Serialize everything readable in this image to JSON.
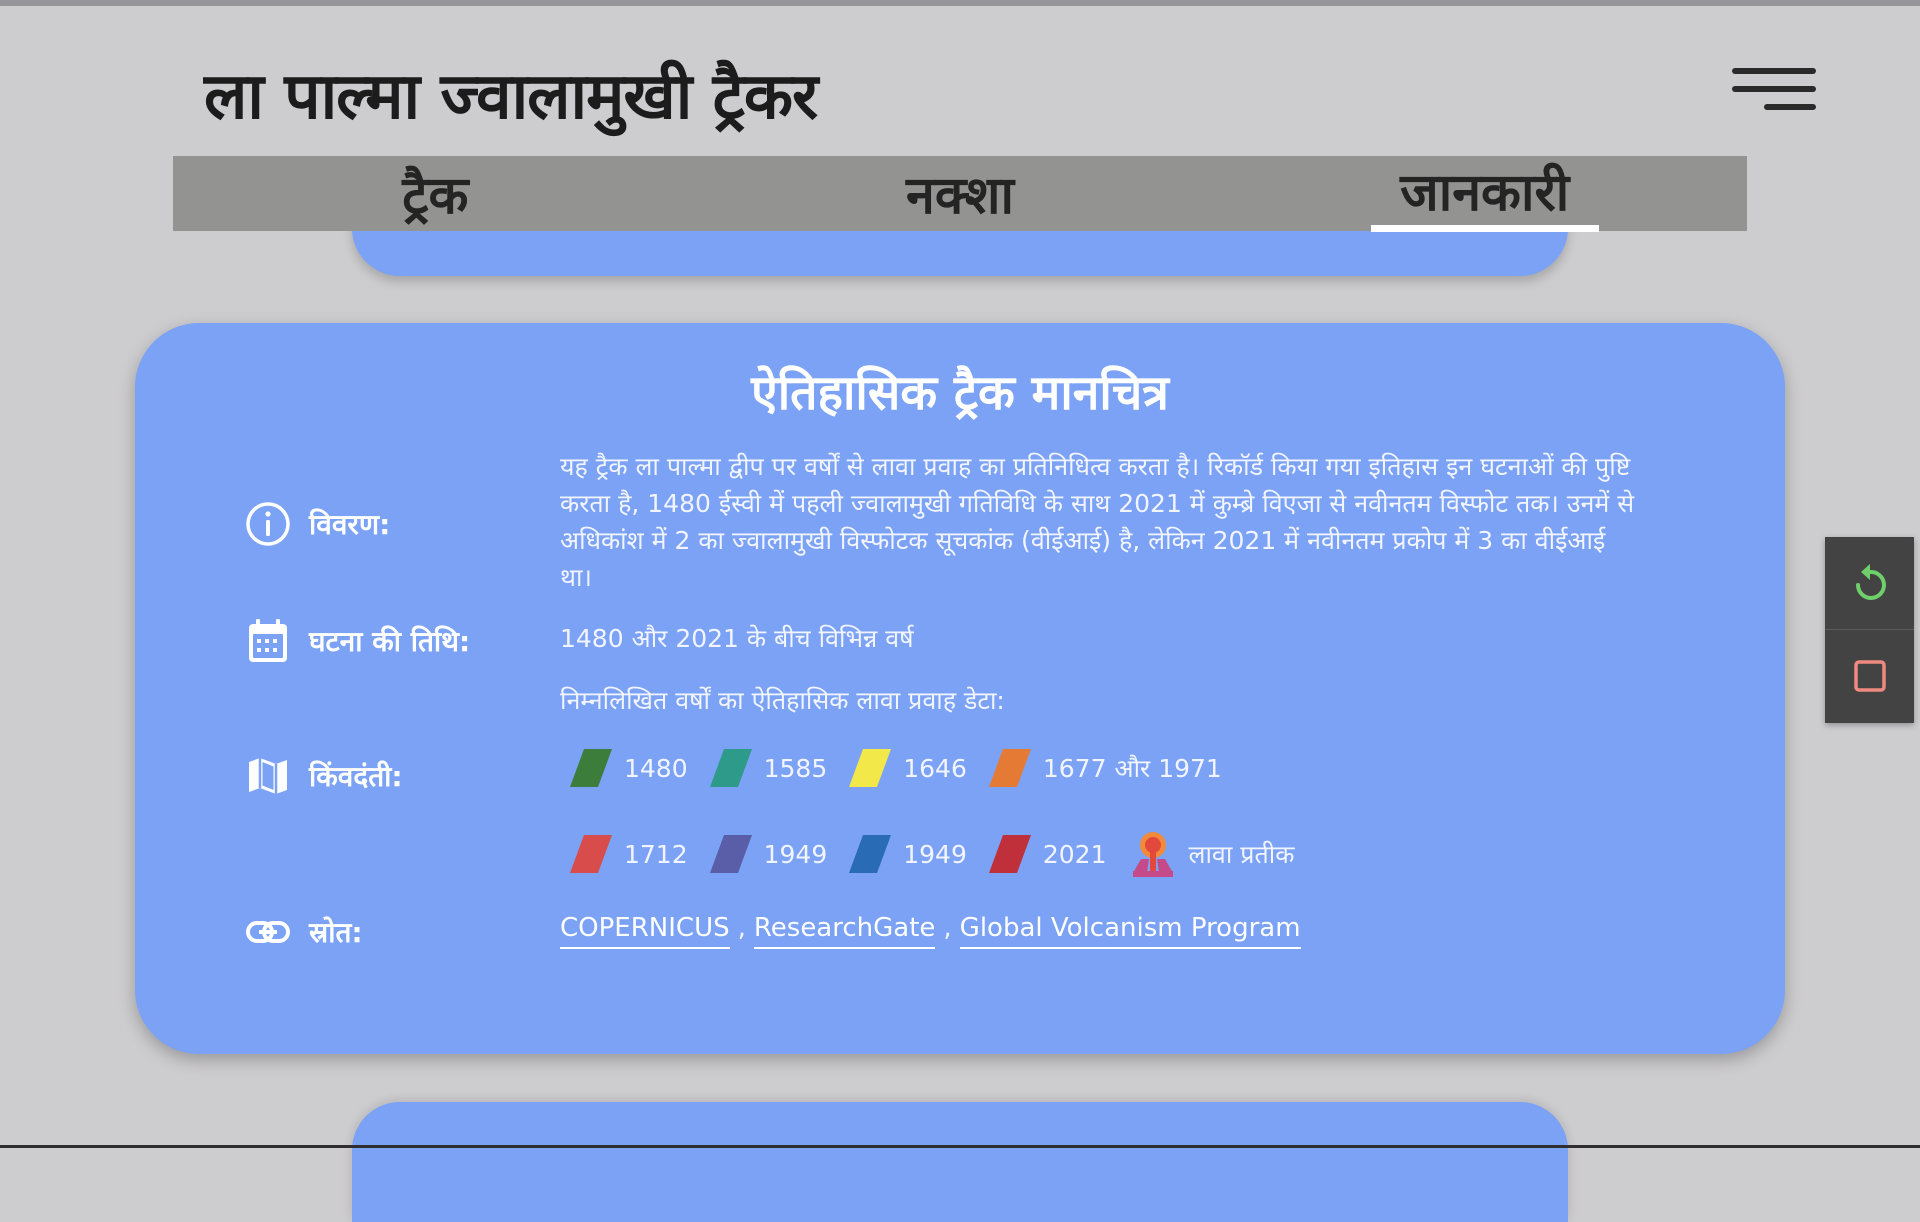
{
  "app": {
    "title": "ला पाल्मा ज्वालामुखी ट्रैकर"
  },
  "tabs": [
    {
      "label": "ट्रैक",
      "active": false
    },
    {
      "label": "नक्शा",
      "active": false
    },
    {
      "label": "जानकारी",
      "active": true
    }
  ],
  "card": {
    "title": "ऐतिहासिक ट्रैक मानचित्र",
    "description_label": "विवरण:",
    "description": "यह ट्रैक ला पाल्मा द्वीप पर वर्षों से लावा प्रवाह का प्रतिनिधित्व करता है। रिकॉर्ड किया गया इतिहास इन घटनाओं की पुष्टि करता है, 1480 ईस्वी में पहली ज्वालामुखी गतिविधि के साथ 2021 में कुम्ब्रे विएजा से नवीनतम विस्फोट तक। उनमें से अधिकांश में 2 का ज्वालामुखी विस्फोटक सूचकांक (वीईआई) है, लेकिन 2021 में नवीनतम प्रकोप में 3 का वीईआई था।",
    "date_label": "घटना की तिथि:",
    "date_value": "1480 और 2021 के बीच विभिन्न वर्ष",
    "legend_intro": "निम्नलिखित वर्षों का ऐतिहासिक लावा प्रवाह डेटा:",
    "legend_label": "किंवदंती:",
    "legend": [
      {
        "label": "1480",
        "color": "#3d7d3c"
      },
      {
        "label": "1585",
        "color": "#2e9a8a"
      },
      {
        "label": "1646",
        "color": "#f2e84a"
      },
      {
        "label": "1677 और 1971",
        "color": "#e57a34"
      },
      {
        "label": "1712",
        "color": "#d94c4c"
      },
      {
        "label": "1949",
        "color": "#5a5ea8"
      },
      {
        "label": "1949",
        "color": "#2a6bb5"
      },
      {
        "label": "2021",
        "color": "#c0303a"
      }
    ],
    "lava_symbol_label": "लावा प्रतीक",
    "sources_label": "स्रोत:",
    "sources": [
      "COPERNICUS",
      "ResearchGate",
      "Global Volcanism Program"
    ],
    "source_separator": ","
  },
  "colors": {
    "background": "#cdcccf",
    "card": "#7ba2f4",
    "tabbar": "#939492",
    "reset_icon": "#6fcf6a",
    "stop_icon": "#f08a80"
  },
  "icons": {
    "description": "info-icon",
    "date": "calendar-icon",
    "legend": "map-icon",
    "sources": "link-icon",
    "menu": "hamburger-icon",
    "reset": "refresh-icon",
    "stop": "square-icon"
  }
}
